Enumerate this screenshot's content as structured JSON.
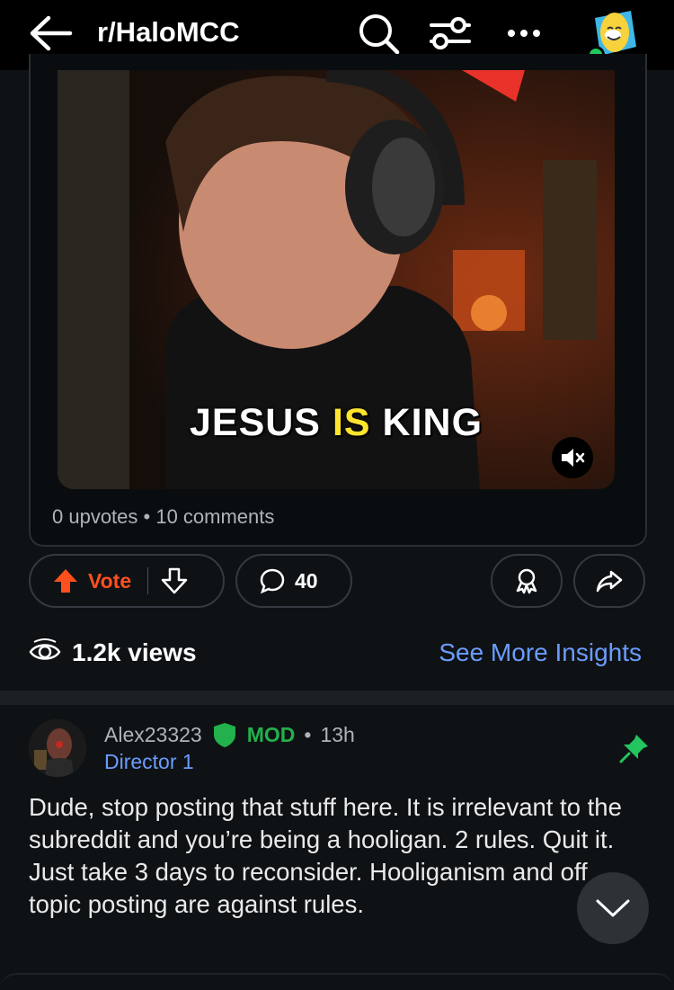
{
  "header": {
    "subreddit": "r/HaloMCC",
    "icons": [
      "back-arrow-icon",
      "search-icon",
      "filter-icon",
      "more-icon",
      "user-avatar"
    ]
  },
  "post": {
    "video_caption_part1": "JESUS ",
    "video_caption_highlight": "IS",
    "video_caption_part2": " KING",
    "meta": "0 upvotes • 10 comments",
    "vote_label": "Vote",
    "comment_count": "40",
    "views": "1.2k views",
    "insights_label": "See More Insights"
  },
  "comment": {
    "username": "Alex23323",
    "mod_label": "MOD",
    "separator": "•",
    "time": "13h",
    "flair": "Director 1",
    "body": "Dude, stop posting that stuff here. It is irrelevant to the subreddit and you’re being a hooligan. 2 rules. Quit it. Just take 3 days to reconsider. Hooliganism and off topic posting are against rules."
  },
  "colors": {
    "accent_vote": "#ff4f1f",
    "link_blue": "#6b9cff",
    "mod_green": "#22b14c",
    "background": "#0f1214"
  }
}
